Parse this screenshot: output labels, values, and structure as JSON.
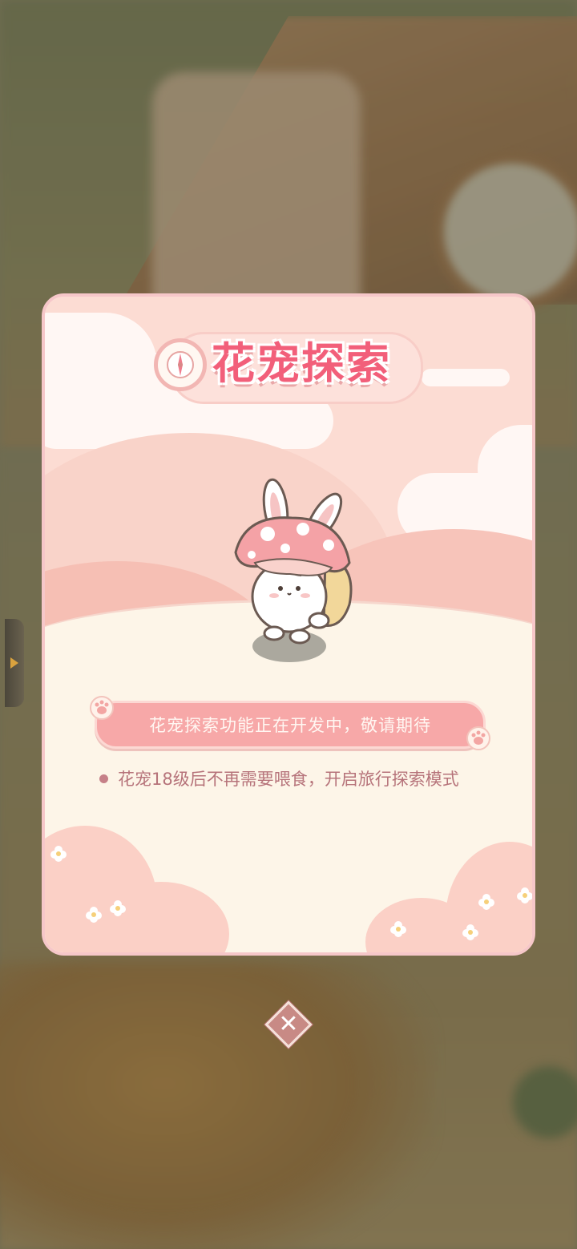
{
  "popup": {
    "title": "花宠探索",
    "notice": "花宠探索功能正在开发中，敬请期待",
    "info_line": "花宠18级后不再需要喂食，开启旅行探索模式"
  },
  "controls": {
    "close_symbol": "✕"
  },
  "colors": {
    "title": "#f25f7a",
    "notice_bar": "#f7a8a8",
    "info_text": "#b6737a",
    "modal_border": "#f6c7c9"
  },
  "icons": [
    "compass-icon",
    "paw-icon",
    "close-icon",
    "side-panel-arrow-icon"
  ]
}
